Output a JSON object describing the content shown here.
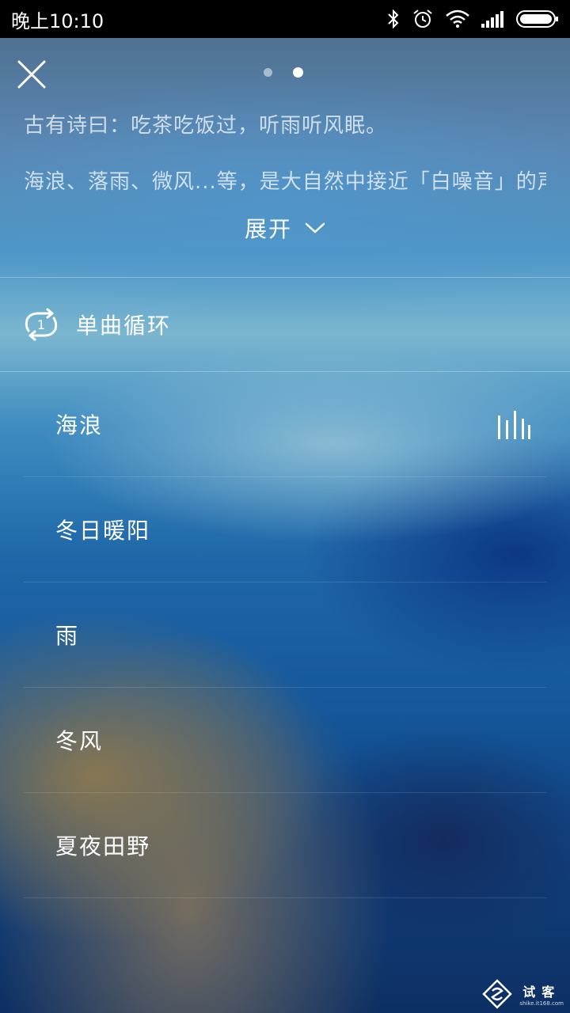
{
  "status_bar": {
    "time": "晚上10:10",
    "icons": [
      "bluetooth-icon",
      "alarm-icon",
      "wifi-icon",
      "signal-icon",
      "battery-icon"
    ]
  },
  "header": {
    "close_icon": "close-icon",
    "pages": 2,
    "active_page": 2
  },
  "intro": {
    "line1": "古有诗曰：吃茶吃饭过，听雨听风眠。",
    "line2": "海浪、落雨、微风...等，是大自然中接近「白噪音」的声",
    "expand_label": "展开"
  },
  "mode": {
    "label": "单曲循环",
    "icon": "repeat-one-icon"
  },
  "tracks": [
    {
      "name": "海浪",
      "playing": true
    },
    {
      "name": "冬日暖阳",
      "playing": false
    },
    {
      "name": "雨",
      "playing": false
    },
    {
      "name": "冬风",
      "playing": false
    },
    {
      "name": "夏夜田野",
      "playing": false
    }
  ],
  "watermark": {
    "cn": "试客",
    "en": "shike.it168.com"
  }
}
